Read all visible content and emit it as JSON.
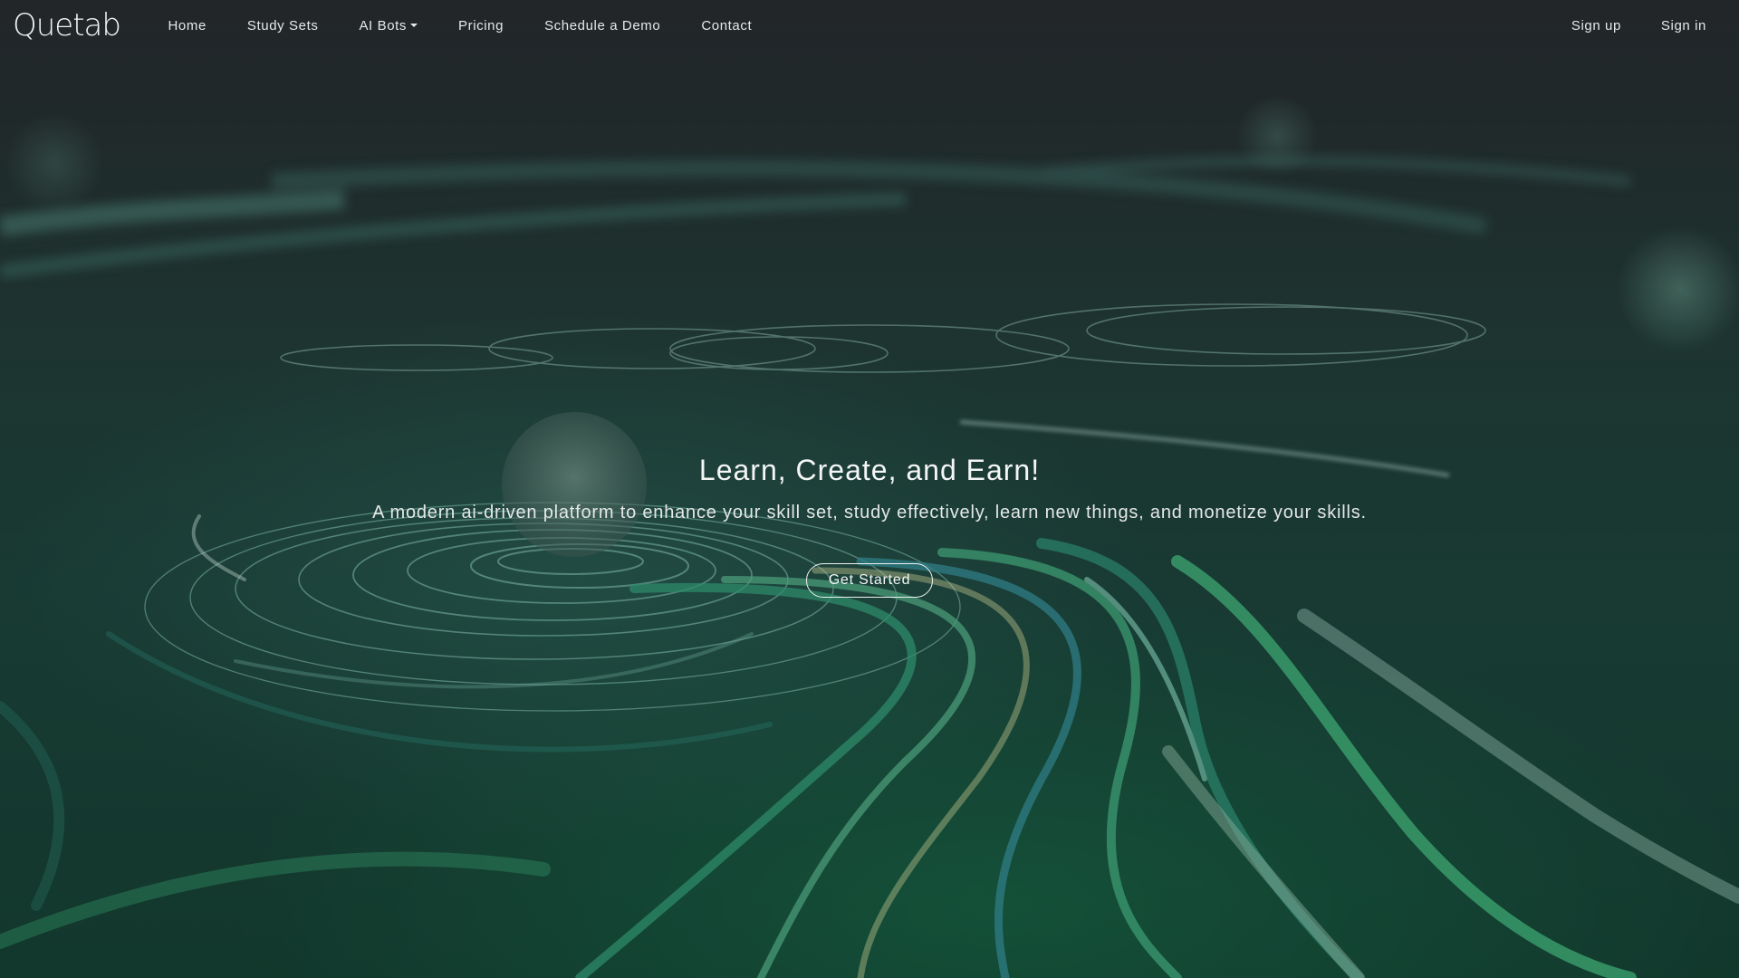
{
  "brand": {
    "name": "Quetab"
  },
  "nav": {
    "items": [
      {
        "label": "Home"
      },
      {
        "label": "Study Sets"
      },
      {
        "label": "AI Bots",
        "has_dropdown": true
      },
      {
        "label": "Pricing"
      },
      {
        "label": "Schedule a Demo"
      },
      {
        "label": "Contact"
      }
    ],
    "right": [
      {
        "label": "Sign up"
      },
      {
        "label": "Sign in"
      }
    ]
  },
  "hero": {
    "title": "Learn, Create, and Earn!",
    "subtitle": "A modern ai-driven platform to enhance your skill set, study effectively, learn new things, and monetize your skills.",
    "cta_label": "Get Started"
  },
  "colors": {
    "background_top": "#222629",
    "background_bottom": "#12372c",
    "accent_green": "#3fae7a",
    "text": "#f4f6f5"
  }
}
